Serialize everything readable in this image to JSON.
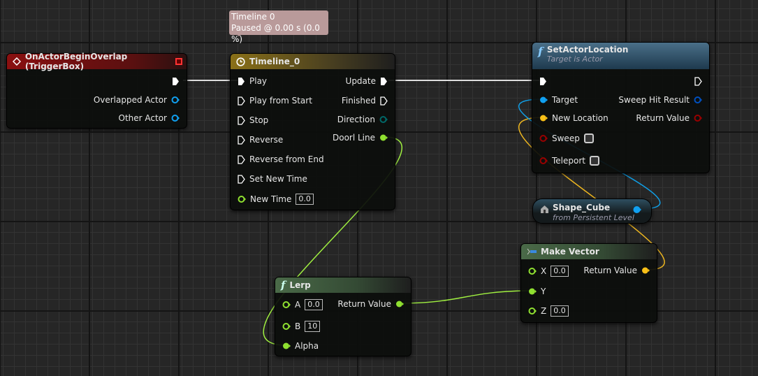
{
  "colors": {
    "exec": "#ffffff",
    "object": "#00a8f0",
    "vector": "#f8c018",
    "float": "#a0f040",
    "bool": "#900000",
    "struct": "#0050c0",
    "enum": "#006060"
  },
  "tooltip": {
    "line1": "Timeline 0",
    "line2": "Paused @ 0.00 s (0.0 %)"
  },
  "event_node": {
    "title": "OnActorBeginOverlap (TriggerBox)",
    "pins": [
      "Overlapped Actor",
      "Other Actor"
    ]
  },
  "timeline_node": {
    "title": "Timeline_0",
    "inputs": [
      "Play",
      "Play from Start",
      "Stop",
      "Reverse",
      "Reverse from End",
      "Set New Time"
    ],
    "new_time_label": "New Time",
    "new_time_value": "0.0",
    "outputs": [
      "Update",
      "Finished",
      "Direction",
      "Doorl Line"
    ]
  },
  "set_actor_location": {
    "title": "SetActorLocation",
    "subtitle": "Target is Actor",
    "inputs": [
      "Target",
      "New Location",
      "Sweep",
      "Teleport"
    ],
    "outputs": [
      "Sweep Hit Result",
      "Return Value"
    ]
  },
  "shape_cube": {
    "title": "Shape_Cube",
    "subtitle": "from Persistent Level"
  },
  "make_vector": {
    "title": "Make Vector",
    "x_label": "X",
    "x_value": "0.0",
    "y_label": "Y",
    "z_label": "Z",
    "z_value": "0.0",
    "output": "Return Value"
  },
  "lerp": {
    "title": "Lerp",
    "a_label": "A",
    "a_value": "0.0",
    "b_label": "B",
    "b_value": "10",
    "alpha_label": "Alpha",
    "output": "Return Value"
  }
}
